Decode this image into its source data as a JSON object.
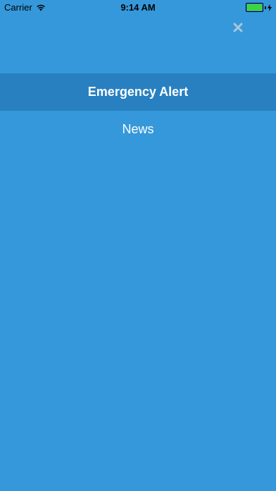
{
  "status_bar": {
    "carrier": "Carrier",
    "time": "9:14 AM",
    "battery_color": "#3FD33F"
  },
  "close": {
    "icon": "close-icon"
  },
  "menu": {
    "items": [
      {
        "label": "Emergency Alert",
        "active": true
      },
      {
        "label": "News",
        "active": false
      }
    ]
  },
  "colors": {
    "background": "#3598DB",
    "active_item_background": "#2880C1",
    "text": "#FFFFFF"
  }
}
